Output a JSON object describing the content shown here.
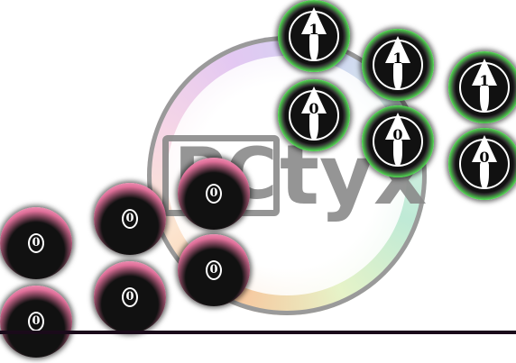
{
  "watermark": {
    "text_box": "PC",
    "text": "tyx"
  },
  "notes_pink": [
    {
      "label": "0"
    },
    {
      "label": "0"
    },
    {
      "label": "0"
    },
    {
      "label": "0"
    },
    {
      "label": "0"
    },
    {
      "label": "0"
    }
  ],
  "notes_green": [
    {
      "label": "1"
    },
    {
      "label": "1"
    },
    {
      "label": "1"
    },
    {
      "label": "0"
    },
    {
      "label": "0"
    },
    {
      "label": "0"
    }
  ],
  "colors": {
    "judgement_line": "#1a0a1a",
    "green_note": "#4fd44f",
    "pink_note": "#f28aa8"
  }
}
